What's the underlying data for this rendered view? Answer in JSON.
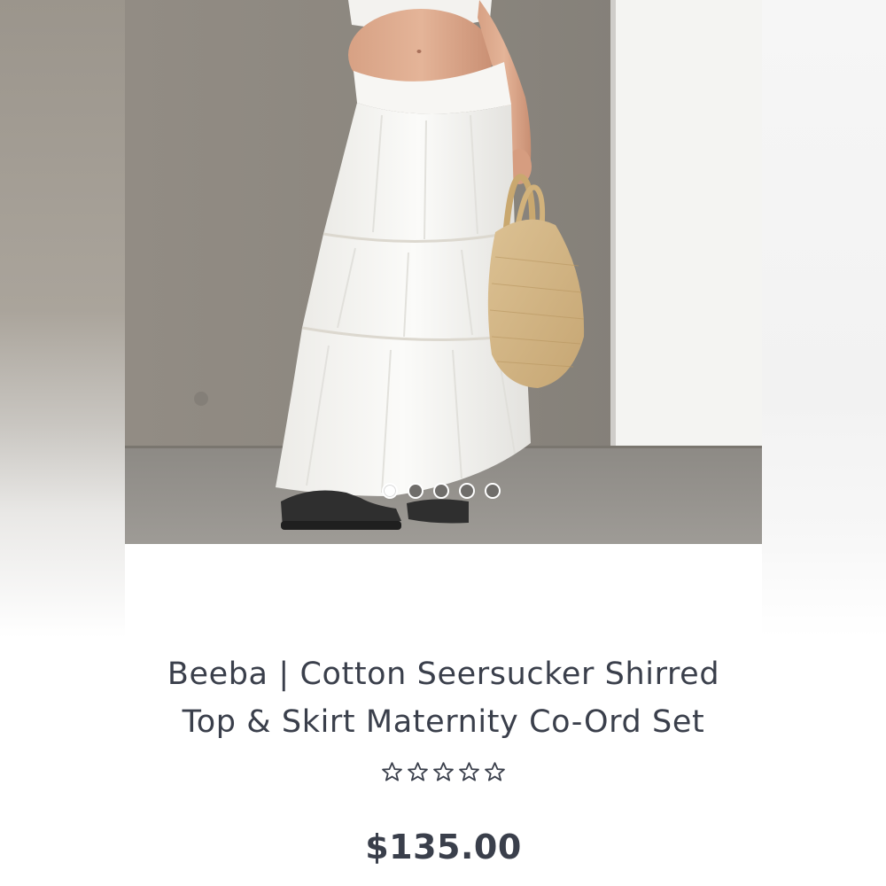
{
  "product": {
    "title_line1": "Beeba | Cotton Seersucker Shirred",
    "title_line2": "Top & Skirt Maternity Co-Ord Set",
    "price": "$135.00",
    "rating_stars": 5,
    "rating_value": 0,
    "image_alt": "Model wearing white tiered maternity skirt holding a straw tote bag"
  },
  "carousel": {
    "total": 5,
    "active_index": 0
  },
  "colors": {
    "text": "#3a3f4b",
    "dot_inactive": "#6f6d6a",
    "dot_active": "#ffffff"
  }
}
